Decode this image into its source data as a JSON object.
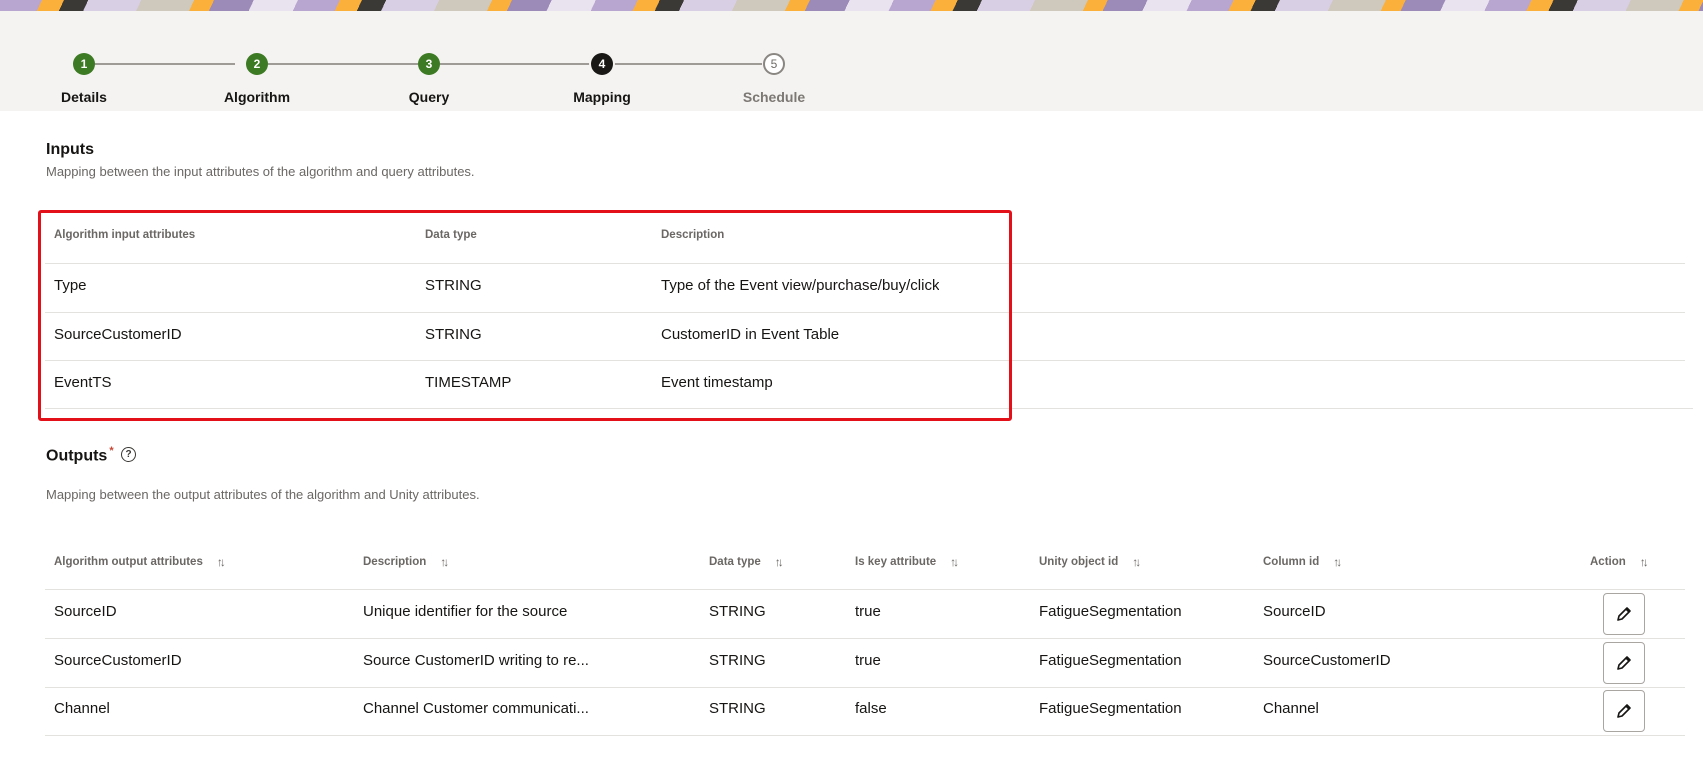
{
  "train": {
    "steps": [
      {
        "number": "1",
        "label": "Details",
        "state": "done"
      },
      {
        "number": "2",
        "label": "Algorithm",
        "state": "done"
      },
      {
        "number": "3",
        "label": "Query",
        "state": "done"
      },
      {
        "number": "4",
        "label": "Mapping",
        "state": "current"
      },
      {
        "number": "5",
        "label": "Schedule",
        "state": "pending"
      }
    ]
  },
  "inputs": {
    "title": "Inputs",
    "description": "Mapping between the input attributes of the algorithm and query attributes.",
    "columns": [
      "Algorithm input attributes",
      "Data type",
      "Description"
    ],
    "rows": [
      [
        "Type",
        "STRING",
        "Type of the Event view/purchase/buy/click"
      ],
      [
        "SourceCustomerID",
        "STRING",
        "CustomerID in Event Table"
      ],
      [
        "EventTS",
        "TIMESTAMP",
        "Event timestamp"
      ]
    ]
  },
  "outputs": {
    "title": "Outputs",
    "required_marker": "*",
    "description": "Mapping between the output attributes of the algorithm and Unity attributes.",
    "columns": [
      "Algorithm output attributes",
      "Description",
      "Data type",
      "Is key attribute",
      "Unity object id",
      "Column id",
      "Action"
    ],
    "rows": [
      [
        "SourceID",
        "Unique identifier for the source",
        "STRING",
        "true",
        "FatigueSegmentation",
        "SourceID"
      ],
      [
        "SourceCustomerID",
        "Source CustomerID writing to re...",
        "STRING",
        "true",
        "FatigueSegmentation",
        "SourceCustomerID"
      ],
      [
        "Channel",
        "Channel Customer communicati...",
        "STRING",
        "false",
        "FatigueSegmentation",
        "Channel"
      ]
    ]
  },
  "icons": {
    "help": "help-circle-icon",
    "sort": "sort-arrows-icon",
    "edit": "pencil-icon"
  },
  "colors": {
    "step_done": "#3c7a23",
    "step_current": "#1a1816",
    "highlight": "#e3101a"
  }
}
